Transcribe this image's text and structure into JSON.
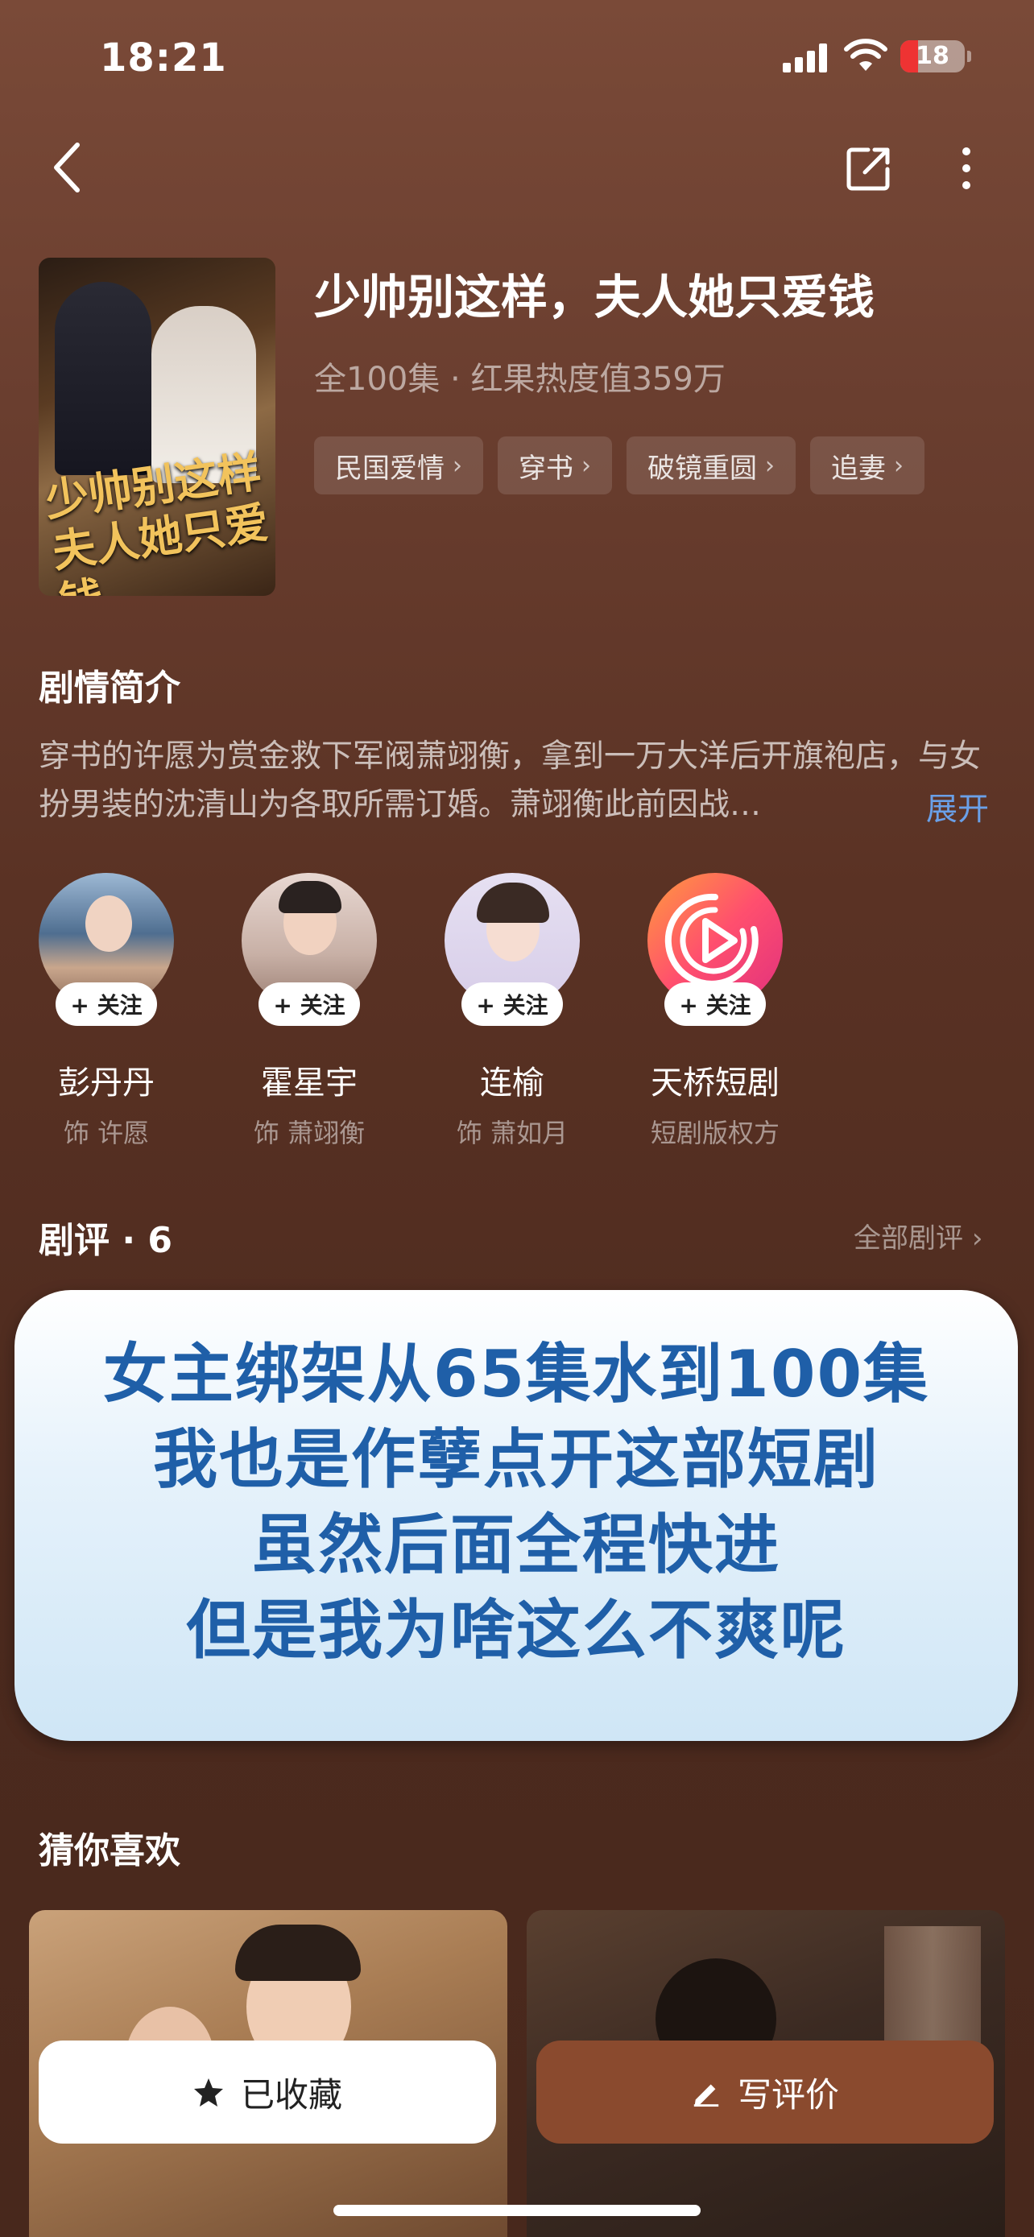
{
  "status": {
    "time": "18:21",
    "battery": "18"
  },
  "show": {
    "title": "少帅别这样，夫人她只爱钱",
    "meta": "全100集 · 红果热度值359万",
    "poster_title_line1": "少帅别这样",
    "poster_title_line2": "夫人她只爱钱",
    "tags": [
      "民国爱情",
      "穿书",
      "破镜重圆",
      "追妻"
    ]
  },
  "synopsis": {
    "title": "剧情简介",
    "text": "穿书的许愿为赏金救下军阀萧翊衡，拿到一万大洋后开旗袍店，与女扮男装的沈清山为各取所需订婚。萧翊衡此前因战…",
    "expand": "展开"
  },
  "cast": [
    {
      "name": "彭丹丹",
      "role": "饰 许愿",
      "follow": "+ 关注"
    },
    {
      "name": "霍星宇",
      "role": "饰 萧翊衡",
      "follow": "+ 关注"
    },
    {
      "name": "连榆",
      "role": "饰 萧如月",
      "follow": "+ 关注"
    },
    {
      "name": "天桥短剧",
      "role": "短剧版权方",
      "follow": "+ 关注"
    }
  ],
  "reviews": {
    "title": "剧评 · 6",
    "all": "全部剧评",
    "overlay_lines": [
      "女主绑架从65集水到100集",
      "我也是作孽点开这部短剧",
      "虽然后面全程快进",
      "但是我为啥这么不爽呢"
    ]
  },
  "recommend": {
    "title": "猜你喜欢"
  },
  "actions": {
    "favorited": "已收藏",
    "write_review": "写评价"
  },
  "colors": {
    "accent": "#8a4a2e",
    "link": "#6aa0e8",
    "overlay_text": "#1f5fa8"
  }
}
